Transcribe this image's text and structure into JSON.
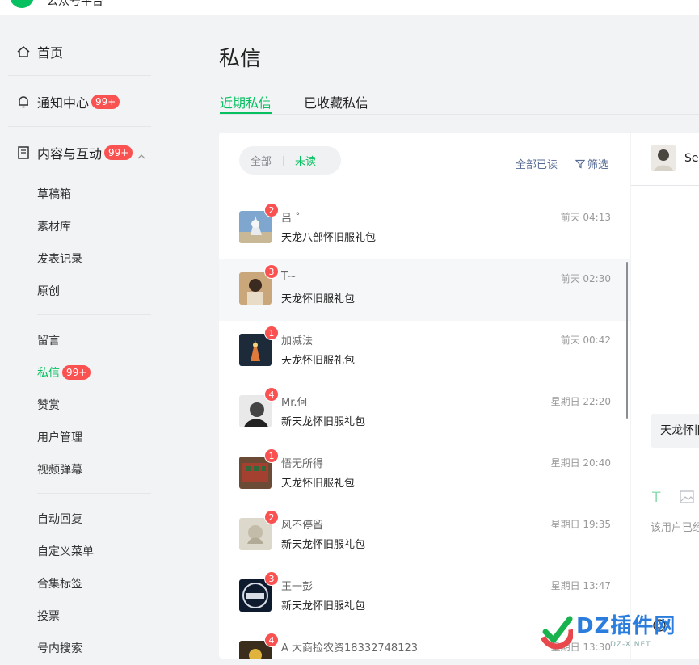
{
  "app": {
    "logo_text": "公众号平台"
  },
  "sidebar": {
    "home": "首页",
    "notifications": "通知中心",
    "notifications_badge": "99+",
    "content": "内容与互动",
    "content_badge": "99+",
    "group1": [
      {
        "label": "草稿箱"
      },
      {
        "label": "素材库"
      },
      {
        "label": "发表记录"
      },
      {
        "label": "原创"
      }
    ],
    "group2": [
      {
        "label": "留言"
      },
      {
        "label": "私信",
        "badge": "99+"
      },
      {
        "label": "赞赏"
      },
      {
        "label": "用户管理"
      },
      {
        "label": "视频弹幕"
      }
    ],
    "group3": [
      {
        "label": "自动回复"
      },
      {
        "label": "自定义菜单"
      },
      {
        "label": "合集标签"
      },
      {
        "label": "投票"
      },
      {
        "label": "号内搜索"
      }
    ]
  },
  "page": {
    "title": "私信",
    "tabs": [
      {
        "label": "近期私信"
      },
      {
        "label": "已收藏私信"
      }
    ]
  },
  "list": {
    "filter_all": "全部",
    "filter_unread": "未读",
    "mark_all_read": "全部已读",
    "filter_button": "筛选",
    "conversations": [
      {
        "name": "吕 ˚",
        "message": "天龙八部怀旧服礼包",
        "time": "前天 04:13",
        "unread": "2"
      },
      {
        "name": "T~",
        "message": "天龙怀旧服礼包",
        "time": "前天 02:30",
        "unread": "3"
      },
      {
        "name": "加减法",
        "message": "天龙怀旧服礼包",
        "time": "前天 00:42",
        "unread": "1"
      },
      {
        "name": "Mr.何",
        "message": "新天龙怀旧服礼包",
        "time": "星期日 22:20",
        "unread": "4"
      },
      {
        "name": "悟无所得",
        "message": "天龙怀旧服礼包",
        "time": "星期日 20:40",
        "unread": "1"
      },
      {
        "name": "风不停留",
        "message": "新天龙怀旧服礼包",
        "time": "星期日 19:35",
        "unread": "2"
      },
      {
        "name": "王一彭",
        "message": "新天龙怀旧服礼包",
        "time": "星期日 13:47",
        "unread": "3"
      },
      {
        "name": "A 大商捡农资18332748123",
        "message": "",
        "time": "星期日 13:30",
        "unread": "4"
      }
    ]
  },
  "chat": {
    "name": "Sen",
    "bubble": "天龙怀旧服礼包",
    "tool_text": "T",
    "hint": "该用户已经"
  },
  "watermark": {
    "text": "DZ插件网",
    "sub": "DZ-X.NET"
  },
  "colors": {
    "accent": "#07c160",
    "badge": "#fa5151",
    "link": "#576b95"
  }
}
